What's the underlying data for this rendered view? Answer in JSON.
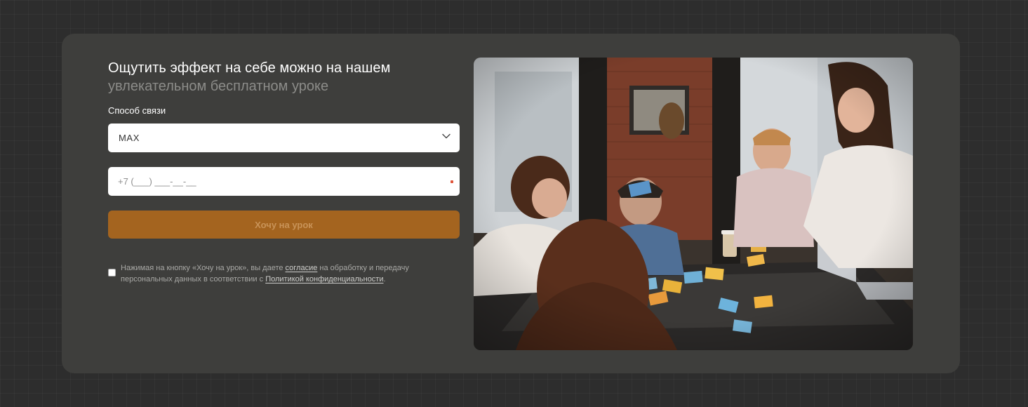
{
  "form": {
    "title_line1": "Ощутить эффект на себе можно на нашем",
    "title_line2": "увлекательном бесплатном уроке",
    "contact_label": "Способ связи",
    "contact_value": "MAX",
    "phone_placeholder": "+7 (___) ___-__-__",
    "submit_label": "Хочу на урок",
    "consent": {
      "text1": "Нажимая на кнопку «Хочу на урок», вы даете ",
      "link1": "согласие",
      "text2": " на обработку и передачу персональных данных в соответствии с ",
      "link2": "Политикой конфиденциальности",
      "text3": "."
    }
  },
  "colors": {
    "page_bg": "#2d2d2d",
    "card_bg": "#3e3e3c",
    "accent": "#a4641f",
    "required": "#e0553a"
  },
  "icons": {
    "select_arrow": "chevron-down-icon"
  },
  "photo": {
    "subject": "people playing a card game at a table"
  }
}
